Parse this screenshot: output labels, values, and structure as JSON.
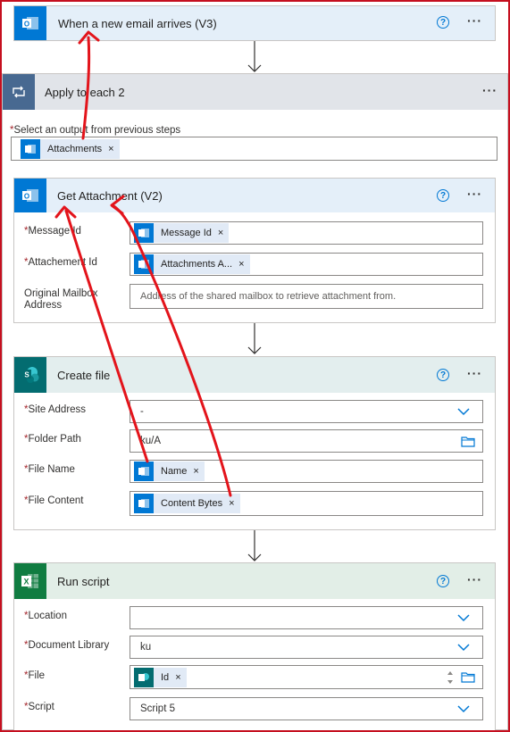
{
  "trigger": {
    "title": "When a new email arrives (V3)",
    "help": "?",
    "more": "···"
  },
  "loop": {
    "title": "Apply to each 2",
    "more": "···",
    "select_label": "Select an output from previous steps",
    "token_label": "Attachments"
  },
  "get_attachment": {
    "title": "Get Attachment (V2)",
    "help": "?",
    "more": "···",
    "fields": {
      "message_id": {
        "label": "Message Id",
        "token": "Message Id"
      },
      "attachment_id": {
        "label": "Attachement Id",
        "token": "Attachments A..."
      },
      "mailbox": {
        "label_1": "Original Mailbox",
        "label_2": "Address",
        "placeholder": "Address of the shared mailbox to retrieve attachment from."
      }
    }
  },
  "create_file": {
    "title": "Create file",
    "help": "?",
    "more": "···",
    "fields": {
      "site": {
        "label": "Site Address",
        "value": "-"
      },
      "folder": {
        "label": "Folder Path",
        "value": "ku/A"
      },
      "file_name": {
        "label": "File Name",
        "token": "Name"
      },
      "content": {
        "label": "File Content",
        "token": "Content Bytes"
      }
    }
  },
  "run_script": {
    "title": "Run script",
    "help": "?",
    "more": "···",
    "fields": {
      "location": {
        "label": "Location"
      },
      "library": {
        "label": "Document Library",
        "value": "ku"
      },
      "file": {
        "label": "File",
        "token": "Id"
      },
      "script": {
        "label": "Script",
        "value": "Script 5"
      }
    }
  },
  "common": {
    "required": "*",
    "token_close": "×"
  },
  "colors": {
    "outlook": "#0078d4",
    "sharepoint": "#036c70",
    "excel": "#107c41",
    "annotation": "#e3141b",
    "frame": "#c50f1f"
  }
}
